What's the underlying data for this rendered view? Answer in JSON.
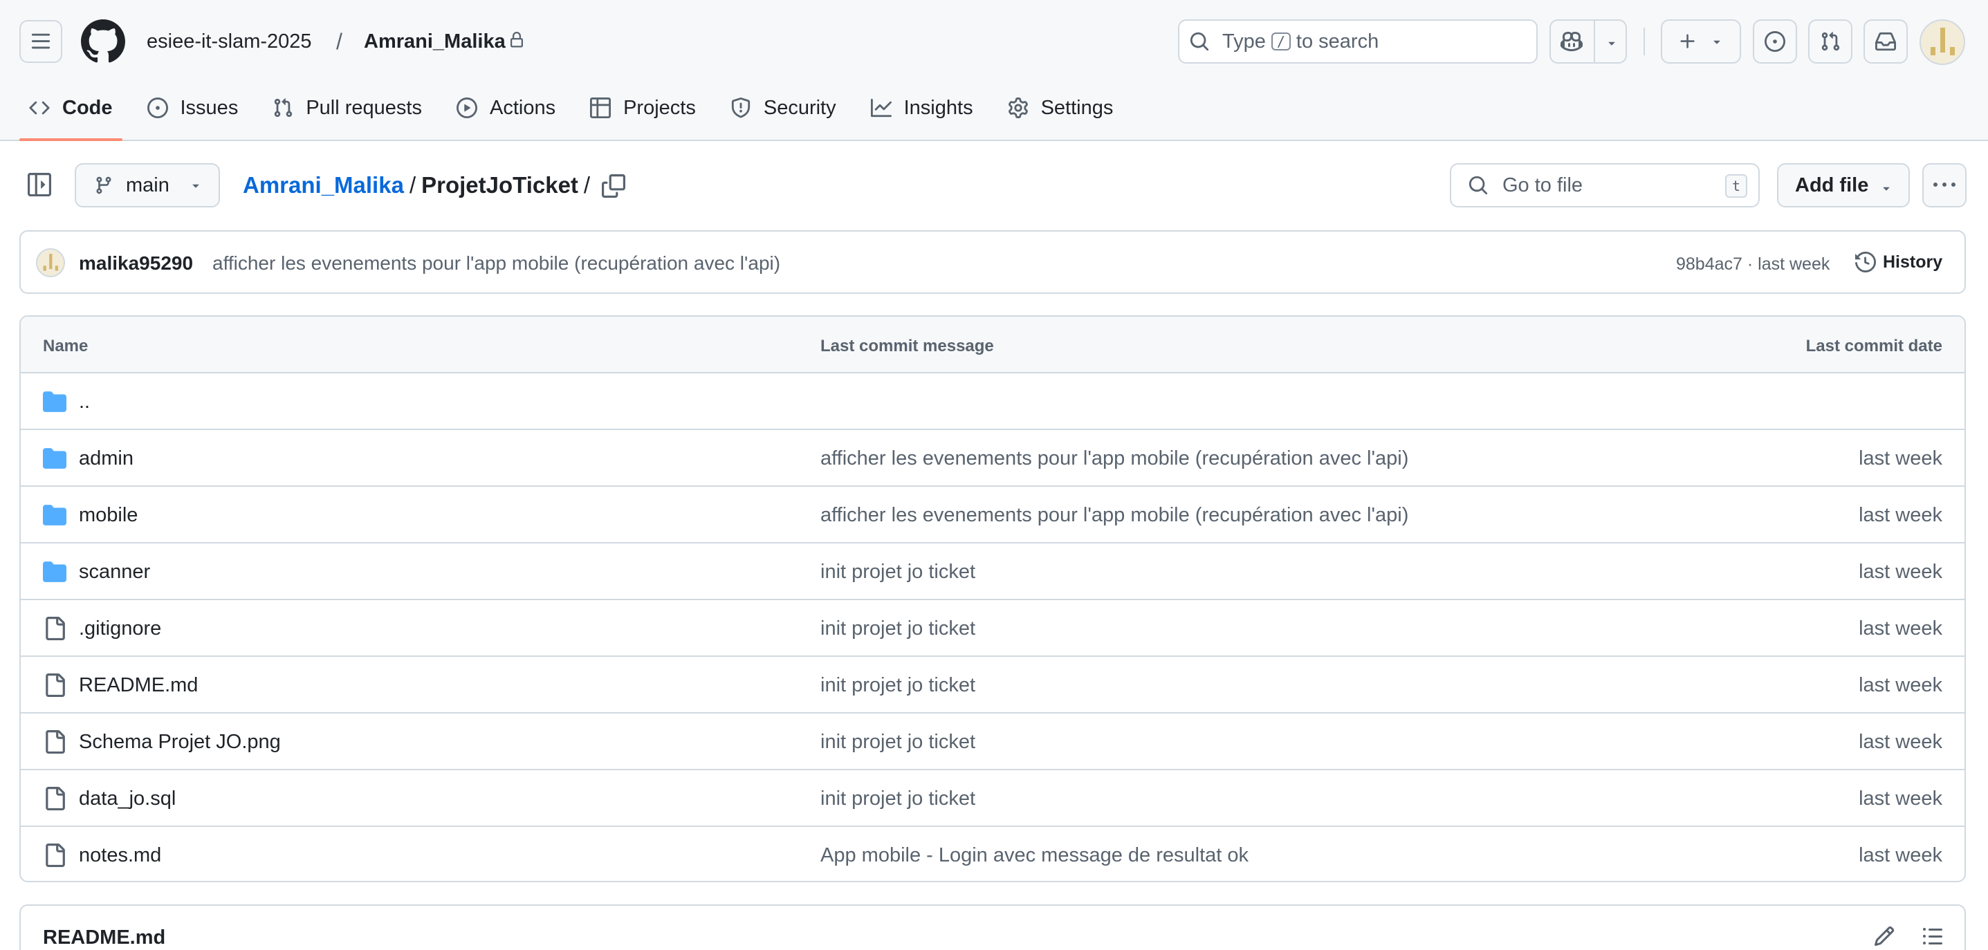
{
  "header": {
    "context_owner": "esiee-it-slam-2025",
    "context_separator": "/",
    "context_repo": "Amrani_Malika",
    "search_prefix": "Type",
    "search_key": "/",
    "search_suffix": "to search"
  },
  "tabs": [
    {
      "label": "Code",
      "icon": "code-icon",
      "active": true
    },
    {
      "label": "Issues",
      "icon": "issue-opened-icon",
      "active": false
    },
    {
      "label": "Pull requests",
      "icon": "git-pull-request-icon",
      "active": false
    },
    {
      "label": "Actions",
      "icon": "play-icon",
      "active": false
    },
    {
      "label": "Projects",
      "icon": "table-icon",
      "active": false
    },
    {
      "label": "Security",
      "icon": "shield-icon",
      "active": false
    },
    {
      "label": "Insights",
      "icon": "graph-icon",
      "active": false
    },
    {
      "label": "Settings",
      "icon": "gear-icon",
      "active": false
    }
  ],
  "toolbar": {
    "branch": "main",
    "breadcrumb_owner": "Amrani_Malika",
    "breadcrumb_sep": "/",
    "breadcrumb_repo": "ProjetJoTicket",
    "breadcrumb_trailing": "/",
    "goto_placeholder": "Go to file",
    "goto_key": "t",
    "add_file": "Add file"
  },
  "latest_commit": {
    "author": "malika95290",
    "message": "afficher les evenements pour l'app mobile (recupération avec l'api)",
    "sha_and_time": "98b4ac7 · last week",
    "history_label": "History"
  },
  "table": {
    "headers": {
      "name": "Name",
      "message": "Last commit message",
      "date": "Last commit date"
    },
    "rows": [
      {
        "type": "folder",
        "name": "..",
        "message": "",
        "date": ""
      },
      {
        "type": "folder",
        "name": "admin",
        "message": "afficher les evenements pour l'app mobile (recupération avec l'api)",
        "date": "last week"
      },
      {
        "type": "folder",
        "name": "mobile",
        "message": "afficher les evenements pour l'app mobile (recupération avec l'api)",
        "date": "last week"
      },
      {
        "type": "folder",
        "name": "scanner",
        "message": "init projet jo ticket",
        "date": "last week"
      },
      {
        "type": "file",
        "name": ".gitignore",
        "message": "init projet jo ticket",
        "date": "last week"
      },
      {
        "type": "file",
        "name": "README.md",
        "message": "init projet jo ticket",
        "date": "last week"
      },
      {
        "type": "file",
        "name": "Schema Projet JO.png",
        "message": "init projet jo ticket",
        "date": "last week"
      },
      {
        "type": "file",
        "name": "data_jo.sql",
        "message": "init projet jo ticket",
        "date": "last week"
      },
      {
        "type": "file",
        "name": "notes.md",
        "message": "App mobile - Login avec message de resultat ok",
        "date": "last week"
      }
    ]
  },
  "readme": {
    "title": "README.md"
  },
  "colors": {
    "link": "#0969da",
    "folder": "#54aeff",
    "tab_underline": "#fd8c73",
    "border": "#d1d9e0",
    "muted": "#59636e"
  }
}
